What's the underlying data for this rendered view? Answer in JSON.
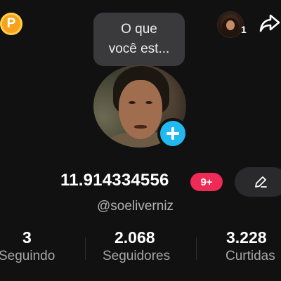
{
  "header": {
    "coin_letter": "P",
    "note_line1": "O que",
    "note_line2": "você est...",
    "friend_count": "1"
  },
  "profile": {
    "display_name": "11.914334556",
    "notification_badge": "9+",
    "handle": "@soeliverniz"
  },
  "stats": [
    {
      "value": "3",
      "label": "Seguindo"
    },
    {
      "value": "2.068",
      "label": "Seguidores"
    },
    {
      "value": "3.228",
      "label": "Curtidas"
    }
  ],
  "colors": {
    "background": "#111111",
    "coin": "#f7a21b",
    "plus_button": "#22b8f0",
    "badge": "#f02a56",
    "edit_button": "#2a2a2c"
  },
  "icons": {
    "share": "share-arrow-icon",
    "edit": "pencil-icon",
    "add": "plus-icon"
  }
}
